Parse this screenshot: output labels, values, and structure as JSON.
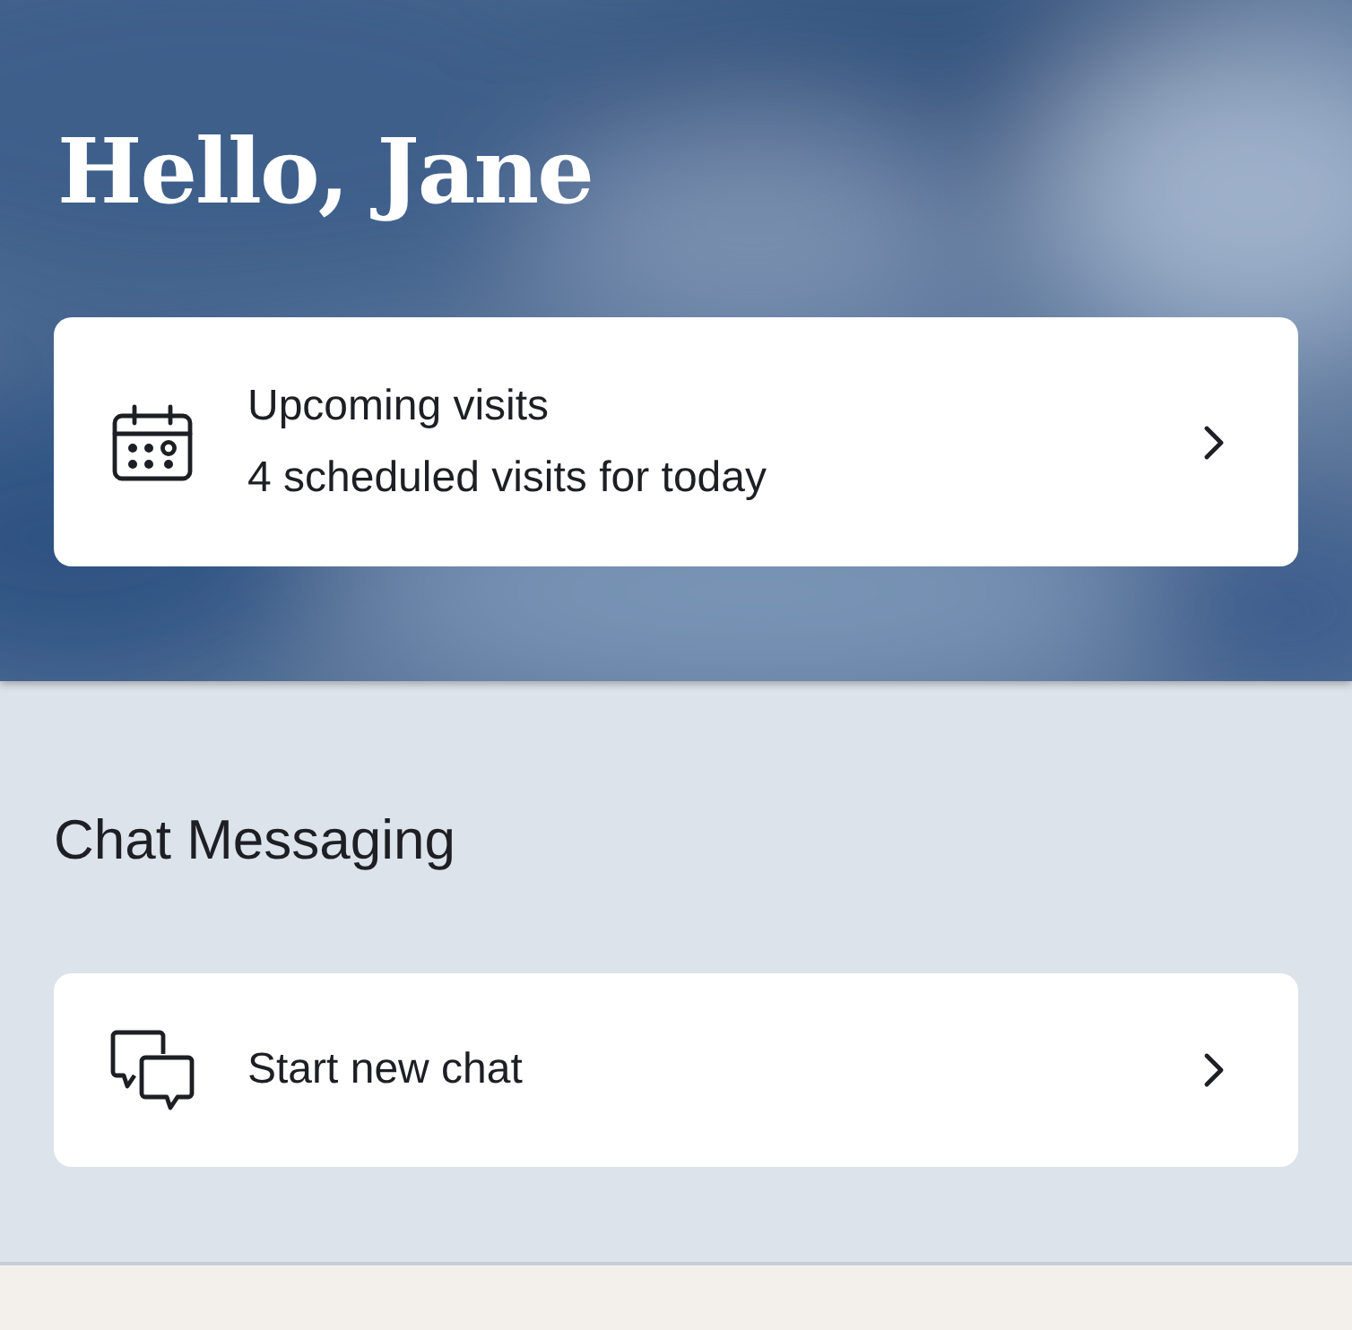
{
  "header": {
    "greeting": "Hello, Jane"
  },
  "visits_card": {
    "kind": "calendar",
    "title": "Upcoming visits",
    "subtitle": "4 scheduled visits for today"
  },
  "chat_section": {
    "heading": "Chat Messaging",
    "card": {
      "kind": "chat",
      "title": "Start new chat"
    }
  }
}
